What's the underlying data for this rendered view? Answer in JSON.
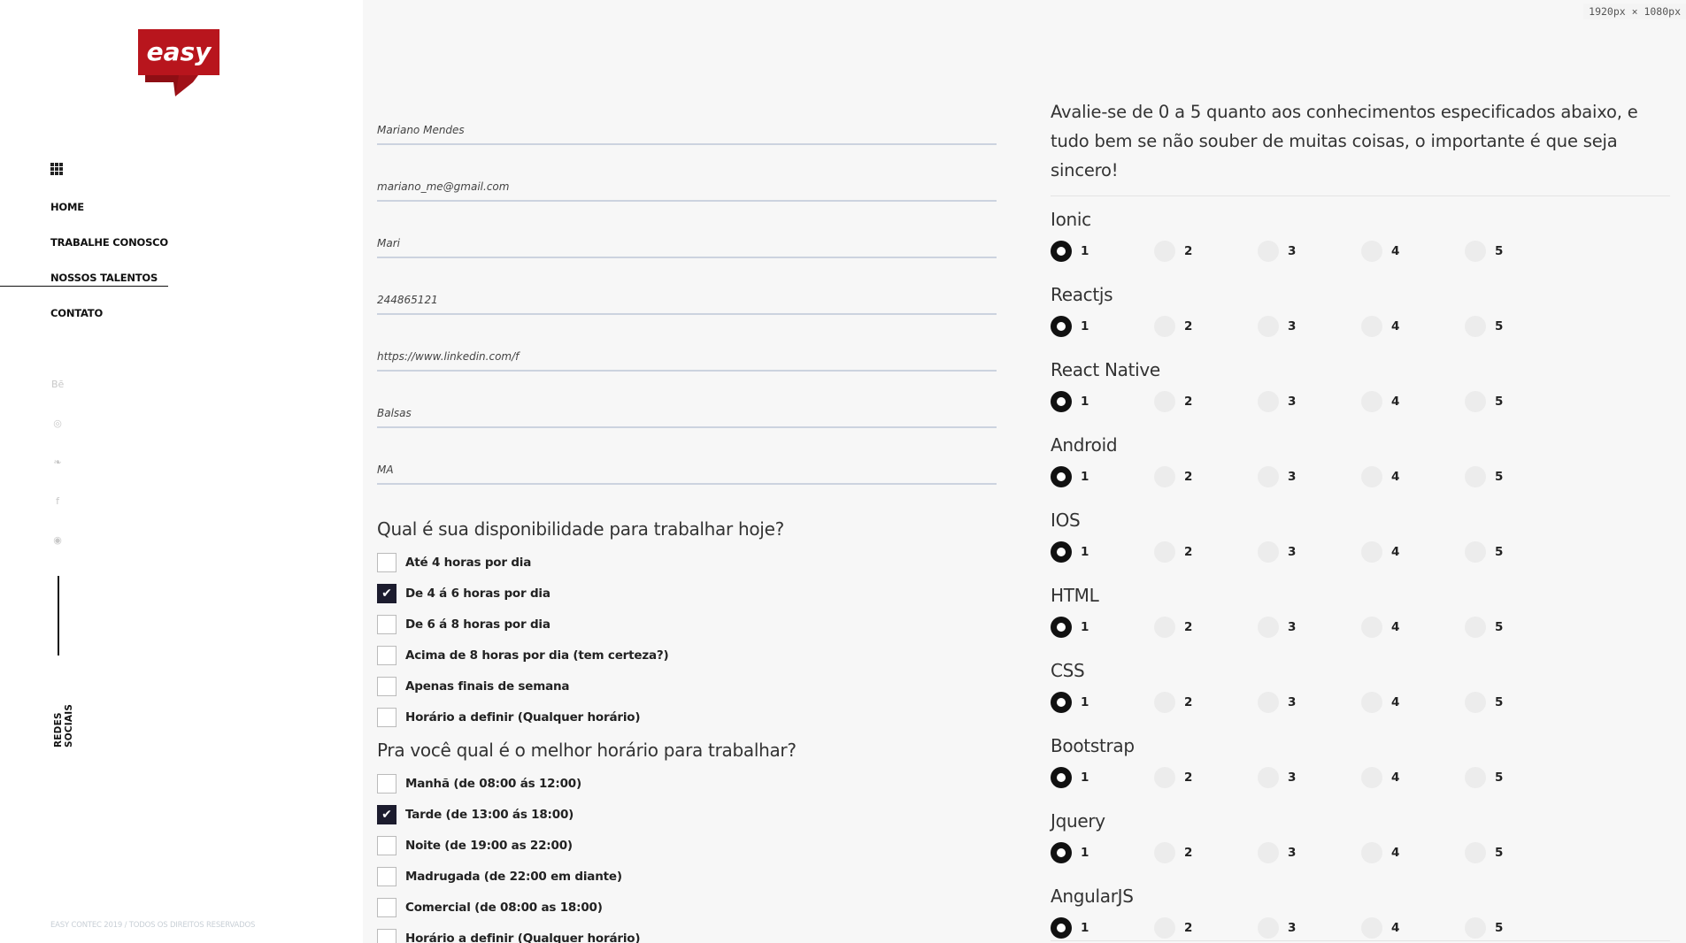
{
  "resolution_badge": "1920px × 1080px",
  "brand": {
    "logo_text": "easy",
    "logo_color": "#b8151d"
  },
  "nav": {
    "items": [
      {
        "label": "HOME"
      },
      {
        "label": "TRABALHE CONOSCO"
      },
      {
        "label": "NOSSOS TALENTOS",
        "active": true
      },
      {
        "label": "CONTATO"
      }
    ]
  },
  "social": {
    "icons": [
      "behance-icon",
      "dribbble-icon",
      "twitter-icon",
      "facebook-icon",
      "instagram-icon"
    ],
    "label": "REDES SOCIAIS"
  },
  "footer": {
    "copyright": "EASY CONTEC 2019 / TODOS OS DIREITOS RESERVADOS"
  },
  "form": {
    "fields": [
      {
        "value": "Mariano Mendes"
      },
      {
        "value": "mariano_me@gmail.com"
      },
      {
        "value": "Mari"
      },
      {
        "value": "244865121"
      },
      {
        "value": "https://www.linkedin.com/f"
      },
      {
        "value": "Balsas"
      },
      {
        "value": "MA"
      }
    ],
    "availability": {
      "question": "Qual é sua disponibilidade para trabalhar hoje?",
      "options": [
        {
          "label": "Até 4 horas por dia",
          "checked": false
        },
        {
          "label": "De 4 á 6 horas por dia",
          "checked": true
        },
        {
          "label": "De 6 á 8 horas por dia",
          "checked": false
        },
        {
          "label": "Acima de 8 horas por dia (tem certeza?)",
          "checked": false
        },
        {
          "label": "Apenas finais de semana",
          "checked": false
        },
        {
          "label": "Horário a definir (Qualquer horário)",
          "checked": false
        }
      ]
    },
    "schedule": {
      "question": "Pra você qual é o melhor horário para trabalhar?",
      "options": [
        {
          "label": "Manhã (de 08:00 ás 12:00)",
          "checked": false
        },
        {
          "label": "Tarde (de 13:00 ás 18:00)",
          "checked": true
        },
        {
          "label": "Noite (de 19:00 as 22:00)",
          "checked": false
        },
        {
          "label": "Madrugada (de 22:00 em diante)",
          "checked": false
        },
        {
          "label": "Comercial (de 08:00 as 18:00)",
          "checked": false
        },
        {
          "label": "Horário a definir (Qualquer horário)",
          "checked": false
        }
      ]
    }
  },
  "skills": {
    "intro": "Avalie-se de 0 a 5 quanto aos conhecimentos especificados abaixo, e tudo bem se não souber de muitas coisas, o importante é que seja sincero!",
    "scale": [
      "1",
      "2",
      "3",
      "4",
      "5"
    ],
    "items": [
      {
        "name": "Ionic",
        "selected": 1
      },
      {
        "name": "Reactjs",
        "selected": 1
      },
      {
        "name": "React Native",
        "selected": 1
      },
      {
        "name": "Android",
        "selected": 1
      },
      {
        "name": "IOS",
        "selected": 1
      },
      {
        "name": "HTML",
        "selected": 1
      },
      {
        "name": "CSS",
        "selected": 1
      },
      {
        "name": "Bootstrap",
        "selected": 1
      },
      {
        "name": "Jquery",
        "selected": 1
      },
      {
        "name": "AngularJS",
        "selected": 1
      }
    ]
  }
}
